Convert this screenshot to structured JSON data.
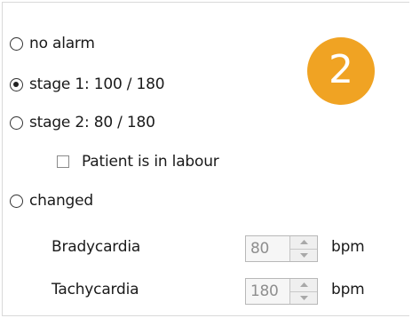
{
  "badge": {
    "number": "2"
  },
  "alarm_options": [
    {
      "label": "no alarm",
      "checked": false
    },
    {
      "label": "stage 1: 100 / 180",
      "checked": true
    },
    {
      "label": "stage 2: 80 / 180",
      "checked": false
    },
    {
      "label": "changed",
      "checked": false
    }
  ],
  "labour": {
    "label": "Patient is in labour",
    "checked": false
  },
  "bradycardia": {
    "label": "Bradycardia",
    "value": "80",
    "unit": "bpm",
    "enabled": false
  },
  "tachycardia": {
    "label": "Tachycardia",
    "value": "180",
    "unit": "bpm",
    "enabled": false
  },
  "colors": {
    "badge": "#f0a323",
    "disabled_text": "#8e8e8e"
  }
}
